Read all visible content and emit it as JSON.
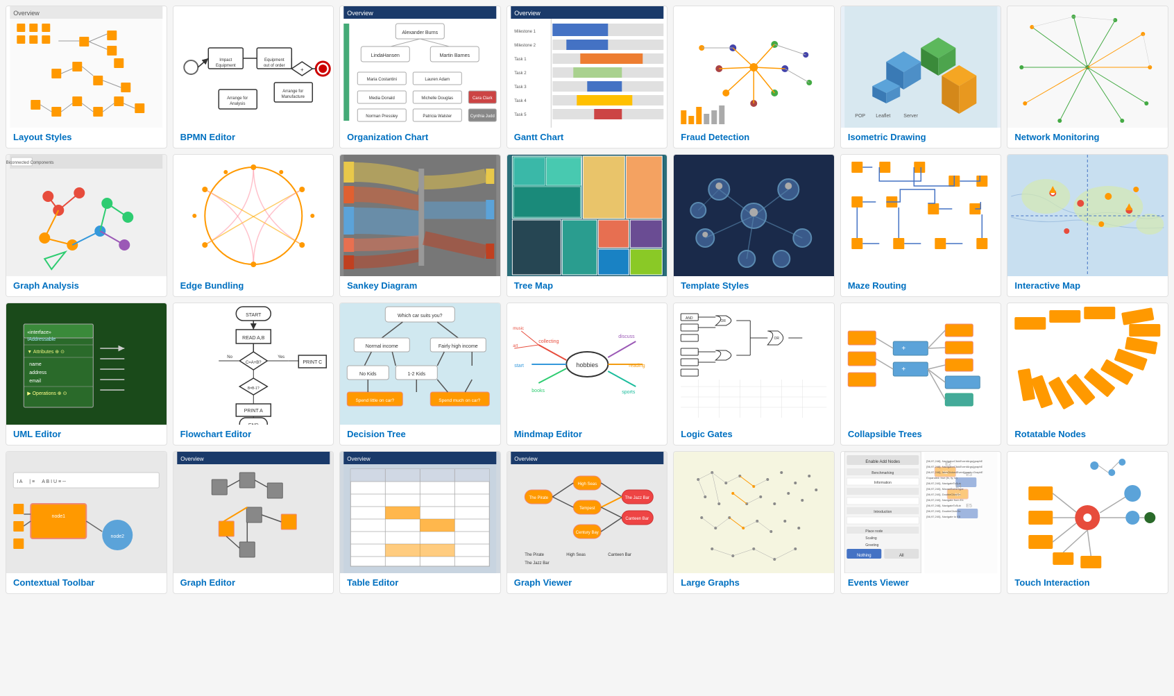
{
  "cards": [
    {
      "id": "layout-styles",
      "label": "Layout Styles",
      "thumb": "layout"
    },
    {
      "id": "bpmn-editor",
      "label": "BPMN Editor",
      "thumb": "bpmn"
    },
    {
      "id": "org-chart",
      "label": "Organization Chart",
      "thumb": "org"
    },
    {
      "id": "gantt-chart",
      "label": "Gantt Chart",
      "thumb": "gantt"
    },
    {
      "id": "fraud-detection",
      "label": "Fraud Detection",
      "thumb": "fraud"
    },
    {
      "id": "isometric-drawing",
      "label": "Isometric Drawing",
      "thumb": "isometric"
    },
    {
      "id": "network-monitoring",
      "label": "Network Monitoring",
      "thumb": "network"
    },
    {
      "id": "graph-analysis",
      "label": "Graph Analysis",
      "thumb": "graph-analysis"
    },
    {
      "id": "edge-bundling",
      "label": "Edge Bundling",
      "thumb": "edge"
    },
    {
      "id": "sankey-diagram",
      "label": "Sankey Diagram",
      "thumb": "sankey"
    },
    {
      "id": "tree-map",
      "label": "Tree Map",
      "thumb": "treemap"
    },
    {
      "id": "template-styles",
      "label": "Template Styles",
      "thumb": "template"
    },
    {
      "id": "maze-routing",
      "label": "Maze Routing",
      "thumb": "maze"
    },
    {
      "id": "interactive-map",
      "label": "Interactive Map",
      "thumb": "imap"
    },
    {
      "id": "uml-editor",
      "label": "UML Editor",
      "thumb": "uml"
    },
    {
      "id": "flowchart-editor",
      "label": "Flowchart Editor",
      "thumb": "flowchart"
    },
    {
      "id": "decision-tree",
      "label": "Decision Tree",
      "thumb": "decision"
    },
    {
      "id": "mindmap-editor",
      "label": "Mindmap Editor",
      "thumb": "mindmap"
    },
    {
      "id": "logic-gates",
      "label": "Logic Gates",
      "thumb": "logic"
    },
    {
      "id": "collapsible-trees",
      "label": "Collapsible Trees",
      "thumb": "collapsible"
    },
    {
      "id": "rotatable-nodes",
      "label": "Rotatable Nodes",
      "thumb": "rotatable"
    },
    {
      "id": "contextual-toolbar",
      "label": "Contextual Toolbar",
      "thumb": "toolbar"
    },
    {
      "id": "graph-editor",
      "label": "Graph Editor",
      "thumb": "geditor"
    },
    {
      "id": "table-editor",
      "label": "Table Editor",
      "thumb": "table"
    },
    {
      "id": "graph-viewer",
      "label": "Graph Viewer",
      "thumb": "gviewer"
    },
    {
      "id": "large-graphs",
      "label": "Large Graphs",
      "thumb": "large"
    },
    {
      "id": "events-viewer",
      "label": "Events Viewer",
      "thumb": "events"
    },
    {
      "id": "touch-interaction",
      "label": "Touch Interaction",
      "thumb": "touch"
    }
  ]
}
